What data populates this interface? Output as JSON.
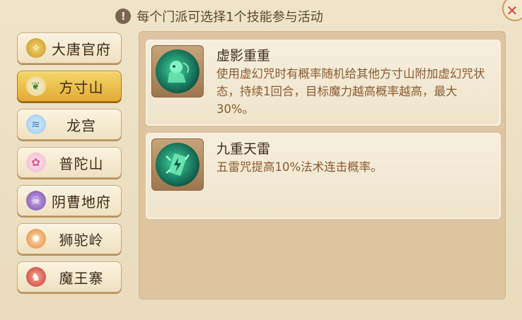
{
  "notice": {
    "icon": "exclamation-icon",
    "text": "每个门派可选择1个技能参与活动"
  },
  "close_button": {
    "icon": "close-icon"
  },
  "sidebar": {
    "items": [
      {
        "label": "大唐官府",
        "icon": "datang-emblem-icon",
        "color": "#d9b43a",
        "active": false
      },
      {
        "label": "方寸山",
        "icon": "fangcun-emblem-icon",
        "color": "#4a9a4a",
        "active": true
      },
      {
        "label": "龙宫",
        "icon": "longgong-emblem-icon",
        "color": "#3b8fd6",
        "active": false
      },
      {
        "label": "普陀山",
        "icon": "putuo-emblem-icon",
        "color": "#e27aa4",
        "active": false
      },
      {
        "label": "阴曹地府",
        "icon": "difu-emblem-icon",
        "color": "#8a5ab8",
        "active": false
      },
      {
        "label": "狮驼岭",
        "icon": "shituo-emblem-icon",
        "color": "#e0843a",
        "active": false
      },
      {
        "label": "魔王寨",
        "icon": "mowang-emblem-icon",
        "color": "#d0402e",
        "active": false
      }
    ]
  },
  "skills": [
    {
      "title": "虚影重重",
      "description": "使用虚幻咒时有概率随机给其他方寸山附加虚幻咒状态，持续1回合，目标魔力越高概率越高，最大30%。",
      "icon": "phantom-figure-icon"
    },
    {
      "title": "九重天雷",
      "description": "五雷咒提高10%法术连击概率。",
      "icon": "thunder-talisman-icon"
    }
  ]
}
